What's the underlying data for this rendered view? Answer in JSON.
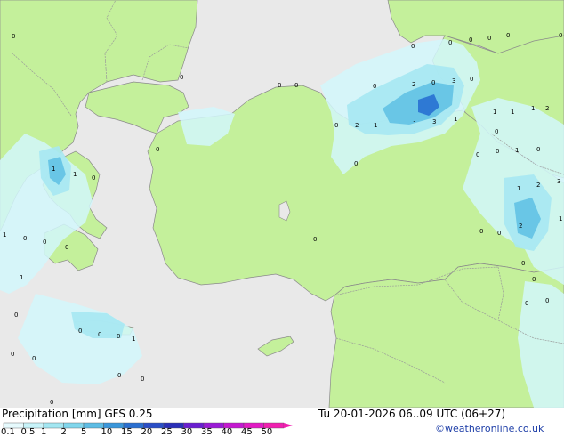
{
  "map": {
    "colors": {
      "sea": "#e9e9e9",
      "land": "#c4f09b",
      "coast": "#8a8a8a",
      "border": "#9a9a9a",
      "precip_light": "#d2f7fb",
      "precip_mid": "#a6e8f2",
      "precip_strong": "#62c2e4",
      "precip_heavy": "#2e79d4"
    },
    "labels": [
      {
        "t": "0"
      },
      {
        "t": "0"
      },
      {
        "t": "0"
      },
      {
        "t": "0"
      },
      {
        "t": "0"
      },
      {
        "t": "0"
      },
      {
        "t": "0"
      },
      {
        "t": "0"
      },
      {
        "t": "0"
      },
      {
        "t": "0"
      },
      {
        "t": "2"
      },
      {
        "t": "0"
      },
      {
        "t": "3"
      },
      {
        "t": "0"
      },
      {
        "t": "1"
      },
      {
        "t": "1"
      },
      {
        "t": "1"
      },
      {
        "t": "2"
      },
      {
        "t": "2"
      },
      {
        "t": "1"
      },
      {
        "t": "1"
      },
      {
        "t": "3"
      },
      {
        "t": "1"
      },
      {
        "t": "0"
      },
      {
        "t": "0"
      },
      {
        "t": "0"
      },
      {
        "t": "0"
      },
      {
        "t": "1"
      },
      {
        "t": "0"
      },
      {
        "t": "0"
      },
      {
        "t": "1"
      },
      {
        "t": "2"
      },
      {
        "t": "3"
      },
      {
        "t": "1"
      },
      {
        "t": "1"
      },
      {
        "t": "0"
      },
      {
        "t": "2"
      },
      {
        "t": "0"
      },
      {
        "t": "0"
      },
      {
        "t": "1"
      },
      {
        "t": "1"
      },
      {
        "t": "0"
      },
      {
        "t": "0"
      },
      {
        "t": "1"
      },
      {
        "t": "0"
      },
      {
        "t": "0"
      },
      {
        "t": "0"
      },
      {
        "t": "0"
      },
      {
        "t": "0"
      },
      {
        "t": "0"
      },
      {
        "t": "0"
      },
      {
        "t": "0"
      },
      {
        "t": "0"
      },
      {
        "t": "0"
      },
      {
        "t": "0"
      },
      {
        "t": "0"
      },
      {
        "t": "1"
      },
      {
        "t": "0"
      },
      {
        "t": "0"
      },
      {
        "t": "0"
      },
      {
        "t": "0"
      },
      {
        "t": "0"
      }
    ]
  },
  "footer": {
    "title": "Precipitation [mm]  GFS 0.25",
    "datetime": "Tu 20-01-2026 06..09 UTC (06+27)",
    "credit": "©weatheronline.co.uk",
    "scale": {
      "labels": [
        "0.1",
        "0.5",
        "1",
        "2",
        "5",
        "10",
        "15",
        "20",
        "25",
        "30",
        "35",
        "40",
        "45",
        "50"
      ],
      "colors": [
        "#e6fafd",
        "#c7f3f9",
        "#a2e6f1",
        "#80d6ec",
        "#5cbce4",
        "#3a96da",
        "#2a6fd0",
        "#2a4ec6",
        "#2a2fb8",
        "#6a1ed0",
        "#9a1ad6",
        "#c418d0",
        "#e21ac4",
        "#f020b0"
      ]
    }
  }
}
